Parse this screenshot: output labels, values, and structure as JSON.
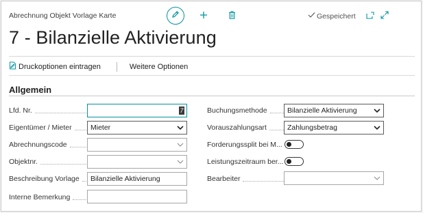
{
  "header": {
    "caption": "Abrechnung Objekt Vorlage Karte",
    "saved_label": "Gespeichert",
    "title": "7 - Bilanzielle Aktivierung"
  },
  "actions": {
    "print_label": "Druckoptionen eintragen",
    "more_label": "Weitere Optionen"
  },
  "section": {
    "title": "Allgemein"
  },
  "fields_left": [
    {
      "label": "Lfd. Nr.",
      "value": "7"
    },
    {
      "label": "Eigentümer / Mieter",
      "value": "Mieter"
    },
    {
      "label": "Abrechnungscode",
      "value": ""
    },
    {
      "label": "Objektnr.",
      "value": ""
    },
    {
      "label": "Beschreibung Vorlage",
      "value": "Bilanzielle Aktivierung"
    },
    {
      "label": "Interne Bemerkung",
      "value": ""
    }
  ],
  "fields_right": [
    {
      "label": "Buchungsmethode",
      "value": "Bilanzielle Aktivierung"
    },
    {
      "label": "Vorauszahlungsart",
      "value": "Zahlungsbetrag"
    },
    {
      "label": "Forderungssplit bei M...",
      "value": "off"
    },
    {
      "label": "Leistungszeitraum ber...",
      "value": "off"
    },
    {
      "label": "Bearbeiter",
      "value": ""
    }
  ],
  "colors": {
    "accent": "#00939f"
  },
  "icons": [
    "edit-icon",
    "plus-icon",
    "trash-icon",
    "checkmark-icon",
    "popout-icon",
    "expand-icon",
    "print-icon",
    "chevron-down-icon"
  ]
}
